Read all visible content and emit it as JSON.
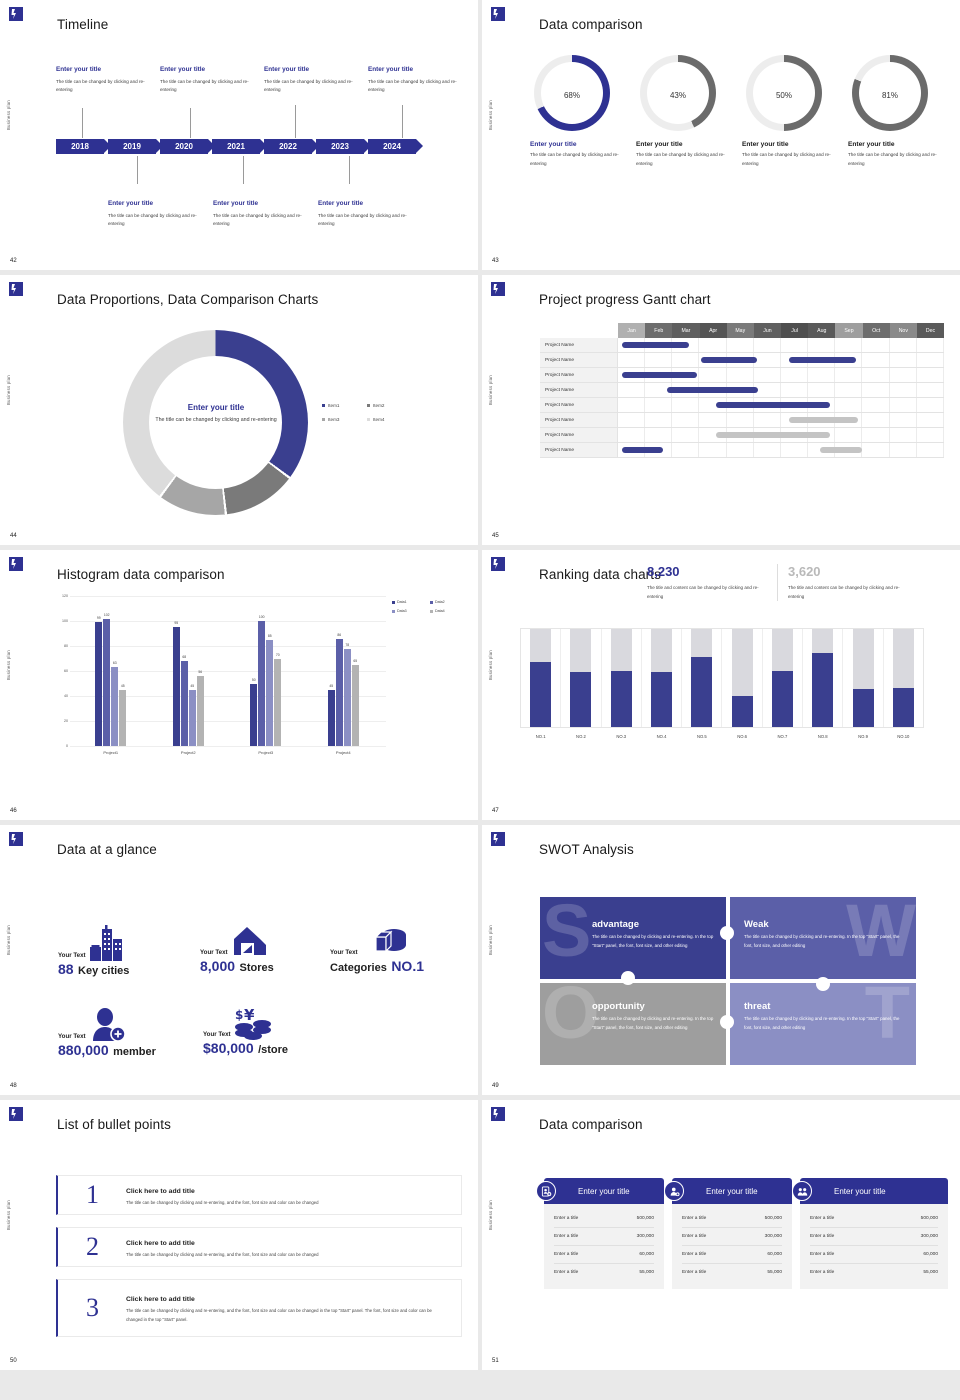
{
  "common": {
    "side_label": "Business plan",
    "logo_name": "deck-logo",
    "placeholder_title": "Enter your title",
    "placeholder_body": "The title can be changed by clicking and re-entering",
    "colors": {
      "brand": "#2e3192",
      "brand_mid": "#5b5fa8",
      "brand_light": "#8b8fc4",
      "gray": "#9e9e9e",
      "gray_light": "#d9d9d9"
    }
  },
  "slides": [
    {
      "page": "42",
      "title": "Timeline",
      "years": [
        "2018",
        "2019",
        "2020",
        "2021",
        "2022",
        "2023",
        "2024"
      ],
      "top_items": [
        {
          "title": "Enter your title",
          "body": "The title can be changed by clicking and re-entering"
        },
        {
          "title": "Enter your title",
          "body": "The title can be changed by clicking and re-entering"
        },
        {
          "title": "Enter your title",
          "body": "The title can be changed by clicking and re-entering"
        },
        {
          "title": "Enter your title",
          "body": "The title can be changed by clicking and re-entering"
        }
      ],
      "bottom_items": [
        {
          "title": "Enter your title",
          "body": "The title can be changed by clicking and re-entering"
        },
        {
          "title": "Enter your title",
          "body": "The title can be changed by clicking and re-entering"
        },
        {
          "title": "Enter your title",
          "body": "The title can be changed by clicking and re-entering"
        }
      ]
    },
    {
      "page": "43",
      "title": "Data comparison",
      "chart_data": {
        "type": "pie",
        "title": "Data comparison",
        "categories": [
          "Enter your title",
          "Enter your title",
          "Enter your title",
          "Enter your title"
        ],
        "values": [
          68,
          43,
          50,
          81
        ],
        "value_suffix": "%",
        "colors": [
          "#2e3192",
          "#6b6b6b",
          "#6b6b6b",
          "#6b6b6b"
        ]
      },
      "rings": [
        {
          "value": "68",
          "unit": "%",
          "title": "Enter your title",
          "body": "The title can be changed by clicking and re-entering"
        },
        {
          "value": "43",
          "unit": "%",
          "title": "Enter your title",
          "body": "The title can be changed by clicking and re-entering"
        },
        {
          "value": "50",
          "unit": "%",
          "title": "Enter your title",
          "body": "The title can be changed by clicking and re-entering"
        },
        {
          "value": "81",
          "unit": "%",
          "title": "Enter your title",
          "body": "The title can be changed by clicking and re-entering"
        }
      ]
    },
    {
      "page": "44",
      "title": "Data Proportions, Data Comparison Charts",
      "center_title": "Enter your title",
      "center_body": "The title can be changed by clicking and re-entering",
      "legend": [
        "Item1",
        "Item2",
        "Item3",
        "Item4"
      ],
      "chart_data": {
        "type": "pie",
        "title": "Data Proportions, Data Comparison Charts",
        "categories": [
          "Item1",
          "Item2",
          "Item3",
          "Item4"
        ],
        "values": [
          35,
          13,
          12,
          40
        ],
        "colors": [
          "#3a3f8f",
          "#7a7a7a",
          "#a6a6a6",
          "#dcdcdc"
        ],
        "legend_position": "right"
      }
    },
    {
      "page": "45",
      "title": "Project progress Gantt chart",
      "months": [
        "Jan",
        "Feb",
        "Mar",
        "Apr",
        "May",
        "Jun",
        "Jul",
        "Aug",
        "Sep",
        "Oct",
        "Nov",
        "Dec"
      ],
      "row_label": "Project Name",
      "chart_data": {
        "type": "bar",
        "title": "Project progress Gantt chart",
        "categories": [
          "Jan",
          "Feb",
          "Mar",
          "Apr",
          "May",
          "Jun",
          "Jul",
          "Aug",
          "Sep",
          "Oct",
          "Nov",
          "Dec"
        ],
        "tasks": [
          {
            "name": "Project Name",
            "start": 0.15,
            "end": 2.6,
            "color": "#3a3f8f"
          },
          {
            "name": "Project Name",
            "start": 3.1,
            "end": 5.1,
            "color": "#3a3f8f"
          },
          {
            "name": "Project Name",
            "start": 6.3,
            "end": 8.4,
            "color": "#3a3f8f"
          },
          {
            "name": "Project Name",
            "start": 0.15,
            "end": 2.9,
            "color": "#3a3f8f"
          },
          {
            "name": "Project Name",
            "start": 2.0,
            "end": 5.4,
            "color": "#3a3f8f"
          },
          {
            "name": "Project Name",
            "start": 3.5,
            "end": 7.6,
            "color": "#3a3f8f"
          },
          {
            "name": "Project Name",
            "start": 6.3,
            "end": 8.5,
            "color": "#c4c4c4"
          },
          {
            "name": "Project Name",
            "start": 3.5,
            "end": 7.5,
            "color": "#c4c4c4"
          },
          {
            "name": "Project Name",
            "start": 0.15,
            "end": 1.5,
            "color": "#3a3f8f"
          },
          {
            "name": "Project Name",
            "start": 8.0,
            "end": 9.6,
            "color": "#c4c4c4"
          }
        ]
      }
    },
    {
      "page": "46",
      "title": "Histogram data comparison",
      "chart_data": {
        "type": "bar",
        "title": "Histogram data comparison",
        "categories": [
          "Project1",
          "Project2",
          "Project3",
          "Project4"
        ],
        "series": [
          {
            "name": "Data1",
            "values": [
              99,
              95,
              50,
              45
            ],
            "color": "#3a3f8f"
          },
          {
            "name": "Data2",
            "values": [
              102,
              68,
              100,
              86
            ],
            "color": "#5b5fa8"
          },
          {
            "name": "Data3",
            "values": [
              63,
              45,
              85,
              78
            ],
            "color": "#8b8fc4"
          },
          {
            "name": "Data4",
            "values": [
              45,
              56,
              70,
              65
            ],
            "color": "#b3b3b3"
          }
        ],
        "ylabel": "",
        "xlabel": "",
        "ylim": [
          0,
          120
        ],
        "yticks": [
          "0",
          "20",
          "40",
          "60",
          "80",
          "100",
          "120"
        ],
        "grid": true,
        "legend_position": "top-right"
      }
    },
    {
      "page": "47",
      "title": "Ranking data charts",
      "stats": [
        {
          "number": "8,230",
          "color": "#2e3192",
          "desc": "The title and content can be changed by clicking and re-entering"
        },
        {
          "number": "3,620",
          "color": "#b9b9b9",
          "desc": "The title and content can be changed by clicking and re-entering"
        }
      ],
      "chart_data": {
        "type": "bar",
        "title": "Ranking data charts",
        "categories": [
          "NO.1",
          "NO.2",
          "NO.3",
          "NO.4",
          "NO.5",
          "NO.6",
          "NO.7",
          "NO.8",
          "NO.9",
          "NO.10"
        ],
        "values": [
          66,
          56,
          57,
          56,
          71,
          32,
          57,
          76,
          39,
          40
        ],
        "ylim": [
          0,
          100
        ],
        "fill_color": "#3a3f8f",
        "track_color": "#d9d9de"
      }
    },
    {
      "page": "48",
      "title": "Data at a glance",
      "items": [
        {
          "label": "Your Text",
          "value": "88",
          "unit": "Key cities",
          "icon": "city-buildings-icon"
        },
        {
          "label": "Your Text",
          "value": "8,000",
          "unit": "Stores",
          "icon": "storefront-icon"
        },
        {
          "label": "Your Text",
          "value": "NO.1",
          "unit": "Categories",
          "icon": "pie-cylinder-icon",
          "unit_first": true
        },
        {
          "label": "Your Text",
          "value": "880,000",
          "unit": "member",
          "icon": "user-add-icon"
        },
        {
          "label": "Your Text",
          "value": "$80,000",
          "unit": "/store",
          "icon": "coins-icon"
        }
      ]
    },
    {
      "page": "49",
      "title": "SWOT Analysis",
      "quadrants": [
        {
          "letter": "S",
          "heading": "advantage",
          "body": "The title can be changed by clicking and re-entering. In the top \"Start\" panel, the font, font size, and other editing",
          "bg": "#3a3f8f"
        },
        {
          "letter": "W",
          "heading": "Weak",
          "body": "The title can be changed by clicking and re-entering. In the top \"Start\" panel, the font, font size, and other editing",
          "bg": "#5b5fa8"
        },
        {
          "letter": "O",
          "heading": "opportunity",
          "body": "The title can be changed by clicking and re-entering. In the top \"Start\" panel, the font, font size, and other editing",
          "bg": "#9e9e9e"
        },
        {
          "letter": "T",
          "heading": "threat",
          "body": "The title can be changed by clicking and re-entering. In the top \"Start\" panel, the font, font size, and other editing",
          "bg": "#8b8fc4"
        }
      ]
    },
    {
      "page": "50",
      "title": "List of bullet points",
      "bullets": [
        {
          "n": "1",
          "title": "Click here to add title",
          "body": "The title can be changed by clicking and re-entering, and the font, font size and color can be changed"
        },
        {
          "n": "2",
          "title": "Click here to add title",
          "body": "The title can be changed by clicking and re-entering, and the font, font size and color can be changed"
        },
        {
          "n": "3",
          "title": "Click here to add title",
          "body": "The title can be changed by clicking and re-entering, and the font, font size and color can be changed in the top \"Start\" panel. The font, font size and color can be changed in the top \"Start\" panel."
        }
      ]
    },
    {
      "page": "51",
      "title": "Data comparison",
      "cards": [
        {
          "icon": "id-card-add-icon",
          "header": "Enter your title",
          "rows": [
            {
              "label": "Enter a title",
              "value": "500,000"
            },
            {
              "label": "Enter a title",
              "value": "300,000"
            },
            {
              "label": "Enter a title",
              "value": "60,000"
            },
            {
              "label": "Enter a title",
              "value": "55,000"
            }
          ]
        },
        {
          "icon": "user-add-circle-icon",
          "header": "Enter your title",
          "rows": [
            {
              "label": "Enter a title",
              "value": "500,000"
            },
            {
              "label": "Enter a title",
              "value": "300,000"
            },
            {
              "label": "Enter a title",
              "value": "60,000"
            },
            {
              "label": "Enter a title",
              "value": "55,000"
            }
          ]
        },
        {
          "icon": "users-group-icon",
          "header": "Enter your title",
          "rows": [
            {
              "label": "Enter a title",
              "value": "500,000"
            },
            {
              "label": "Enter a title",
              "value": "300,000"
            },
            {
              "label": "Enter a title",
              "value": "60,000"
            },
            {
              "label": "Enter a title",
              "value": "55,000"
            }
          ]
        }
      ]
    }
  ]
}
